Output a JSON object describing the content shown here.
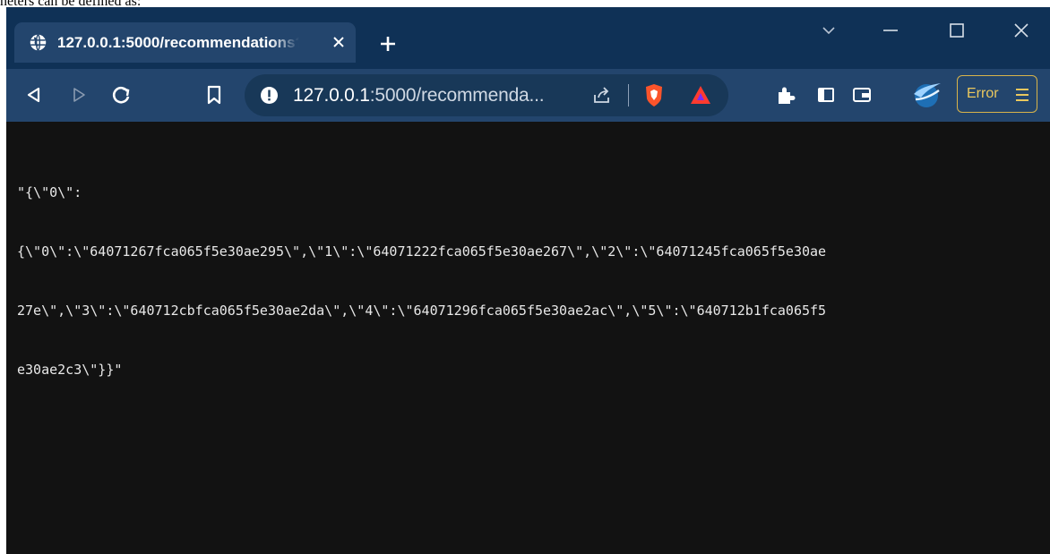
{
  "caption": "neters can be defined as:",
  "tab": {
    "title": "127.0.0.1:5000/recommendations?"
  },
  "address_bar": {
    "host": "127.0.0.1",
    "rest": ":5000/recommenda..."
  },
  "toolbar": {
    "error_label": "Error"
  },
  "content": {
    "lines": [
      "\"{\\\"0\\\":",
      "{\\\"0\\\":\\\"64071267fca065f5e30ae295\\\",\\\"1\\\":\\\"64071222fca065f5e30ae267\\\",\\\"2\\\":\\\"64071245fca065f5e30ae",
      "27e\\\",\\\"3\\\":\\\"640712cbfca065f5e30ae2da\\\",\\\"4\\\":\\\"64071296fca065f5e30ae2ac\\\",\\\"5\\\":\\\"640712b1fca065f5",
      "e30ae2c3\\\"}}\""
    ]
  },
  "colors": {
    "titlebar": "#0f3156",
    "toolbar": "#23456d",
    "page_bg": "#121212",
    "error_accent": "#d9b44a"
  },
  "icons": [
    "globe-icon",
    "close-icon",
    "plus-icon",
    "chevron-down-icon",
    "minimize-icon",
    "maximize-icon",
    "window-close-icon",
    "back-icon",
    "forward-icon",
    "reload-icon",
    "bookmark-icon",
    "info-icon",
    "share-icon",
    "brave-shield-icon",
    "brave-rewards-icon",
    "extensions-icon",
    "sidebar-icon",
    "wallet-icon",
    "vpn-icon",
    "menu-icon"
  ]
}
